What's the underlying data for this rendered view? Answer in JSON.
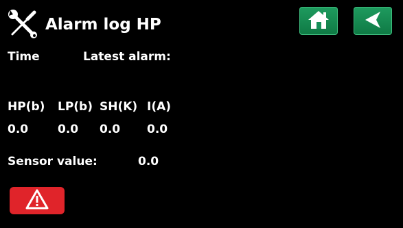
{
  "header": {
    "title": "Alarm log HP",
    "tools_icon": "tools-icon",
    "home_icon": "home-icon",
    "back_icon": "back-arrow-icon"
  },
  "log": {
    "time_label": "Time",
    "latest_alarm_label": "Latest alarm:",
    "columns": [
      "HP(b)",
      "LP(b)",
      "SH(K)",
      "I(A)"
    ],
    "values": [
      "0.0",
      "0.0",
      "0.0",
      "0.0"
    ],
    "sensor_label": "Sensor value:",
    "sensor_value": "0.0"
  },
  "footer": {
    "alarm_icon": "warning-icon"
  },
  "colors": {
    "background": "#000000",
    "text": "#ffffff",
    "nav_button": "#159058",
    "alarm_button": "#e0242a"
  }
}
